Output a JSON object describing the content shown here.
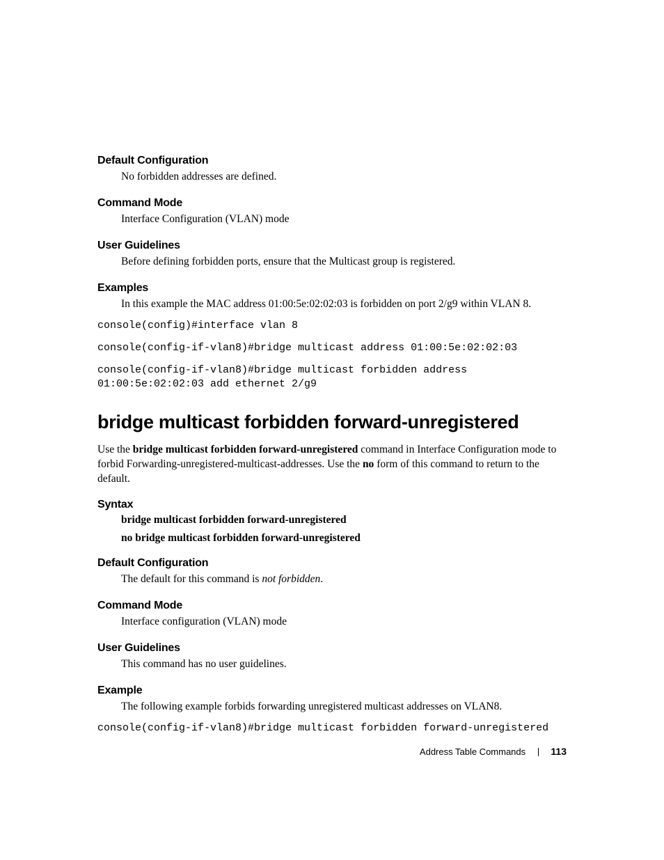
{
  "s1": {
    "heading": "Default Configuration",
    "body": "No forbidden addresses are defined."
  },
  "s2": {
    "heading": "Command Mode",
    "body": "Interface Configuration (VLAN) mode"
  },
  "s3": {
    "heading": "User Guidelines",
    "body": "Before defining forbidden ports, ensure that the Multicast group is registered."
  },
  "s4": {
    "heading": "Examples",
    "body": "In this example the MAC address 01:00:5e:02:02:03 is forbidden on port 2/g9 within VLAN 8."
  },
  "code1": "console(config)#interface vlan 8",
  "code2": "console(config-if-vlan8)#bridge multicast address 01:00:5e:02:02:03",
  "code3": "console(config-if-vlan8)#bridge multicast forbidden address 01:00:5e:02:02:03 add ethernet 2/g9",
  "main": {
    "heading": "bridge multicast forbidden forward-unregistered",
    "intro_a": "Use the ",
    "intro_b": "bridge multicast forbidden forward-unregistered",
    "intro_c": " command in Interface Configuration mode to forbid  Forwarding-unregistered-multicast-addresses. Use the ",
    "intro_d": "no",
    "intro_e": " form of this command to return to the default."
  },
  "s5": {
    "heading": "Syntax",
    "line1": "bridge multicast forbidden forward-unregistered",
    "line2": "no bridge multicast forbidden forward-unregistered"
  },
  "s6": {
    "heading": "Default Configuration",
    "body_a": "The default for this command is ",
    "body_b": "not forbidden",
    "body_c": "."
  },
  "s7": {
    "heading": "Command Mode",
    "body": "Interface configuration (VLAN) mode"
  },
  "s8": {
    "heading": "User Guidelines",
    "body": "This command has no user guidelines."
  },
  "s9": {
    "heading": "Example",
    "body": "The following example forbids forwarding unregistered multicast addresses on VLAN8."
  },
  "code4": "console(config-if-vlan8)#bridge multicast forbidden forward-unregistered",
  "footer": {
    "title": "Address Table Commands",
    "page": "113"
  }
}
